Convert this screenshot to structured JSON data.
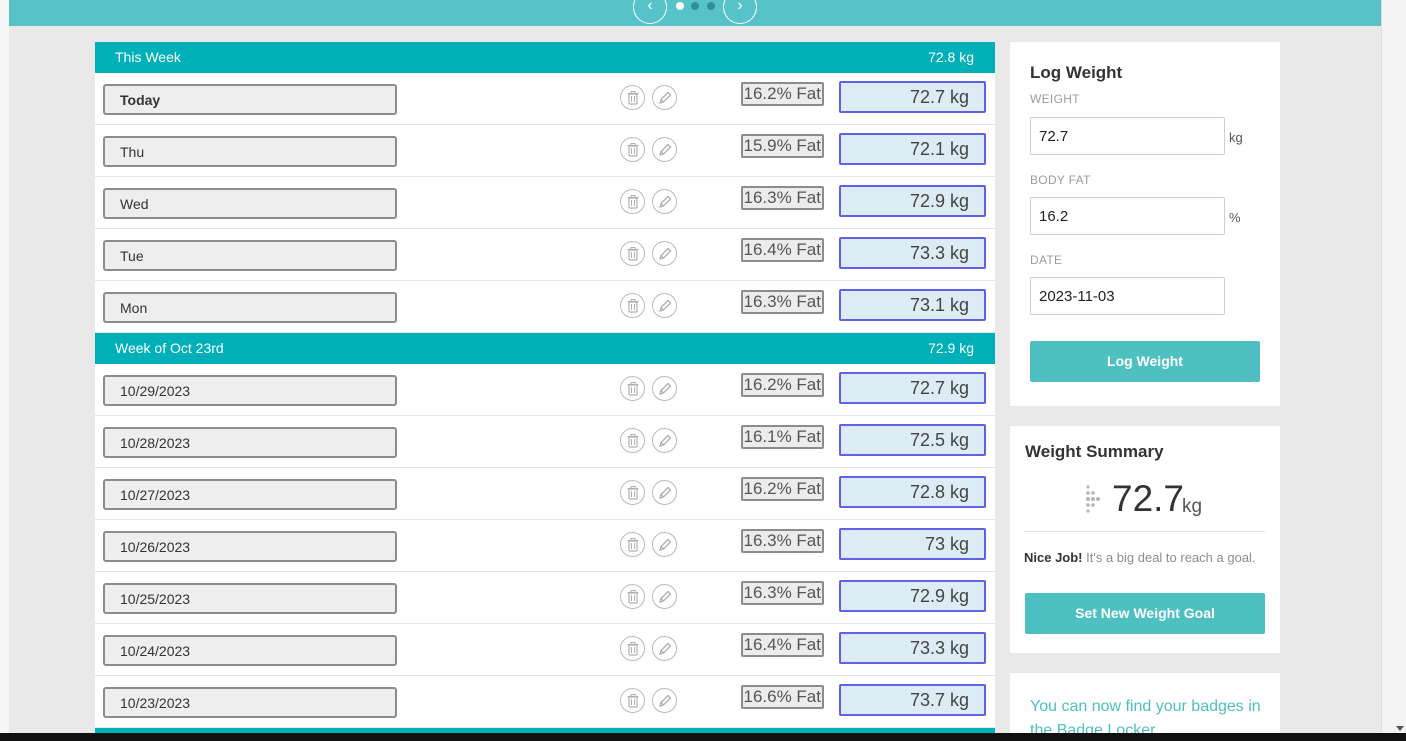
{
  "carousel": {
    "prev_icon": "‹",
    "next_icon": "›",
    "dots": 3,
    "active_dot": 0
  },
  "weeks": [
    {
      "title": "This Week",
      "average": "72.8 kg",
      "entries": [
        {
          "date": "Today",
          "fat": "16.2% Fat",
          "weight": "72.7 kg"
        },
        {
          "date": "Thu",
          "fat": "15.9% Fat",
          "weight": "72.1 kg"
        },
        {
          "date": "Wed",
          "fat": "16.3% Fat",
          "weight": "72.9 kg"
        },
        {
          "date": "Tue",
          "fat": "16.4% Fat",
          "weight": "73.3 kg"
        },
        {
          "date": "Mon",
          "fat": "16.3% Fat",
          "weight": "73.1 kg"
        }
      ]
    },
    {
      "title": "Week of Oct 23rd",
      "average": "72.9 kg",
      "entries": [
        {
          "date": "10/29/2023",
          "fat": "16.2% Fat",
          "weight": "72.7 kg"
        },
        {
          "date": "10/28/2023",
          "fat": "16.1% Fat",
          "weight": "72.5 kg"
        },
        {
          "date": "10/27/2023",
          "fat": "16.2% Fat",
          "weight": "72.8 kg"
        },
        {
          "date": "10/26/2023",
          "fat": "16.3% Fat",
          "weight": "73 kg"
        },
        {
          "date": "10/25/2023",
          "fat": "16.3% Fat",
          "weight": "72.9 kg"
        },
        {
          "date": "10/24/2023",
          "fat": "16.4% Fat",
          "weight": "73.3 kg"
        },
        {
          "date": "10/23/2023",
          "fat": "16.6% Fat",
          "weight": "73.7 kg"
        }
      ]
    }
  ],
  "log_weight": {
    "title": "Log Weight",
    "weight_label": "WEIGHT",
    "weight_value": "72.7",
    "weight_unit": "kg",
    "fat_label": "BODY FAT",
    "fat_value": "16.2",
    "fat_unit": "%",
    "date_label": "DATE",
    "date_value": "2023-11-03",
    "button": "Log Weight"
  },
  "weight_summary": {
    "title": "Weight Summary",
    "value": "72.7",
    "unit": "kg",
    "message_bold": "Nice Job!",
    "message": " It's a big deal to reach a goal.",
    "button": "Set New Weight Goal",
    "icon": "fitbit-dots-icon"
  },
  "badges": {
    "text": "You can now find your badges in the Badge Locker"
  },
  "colors": {
    "teal_header": "#00b0b9",
    "teal_button": "#4fc0c2",
    "kg_border": "#5f62e6"
  }
}
